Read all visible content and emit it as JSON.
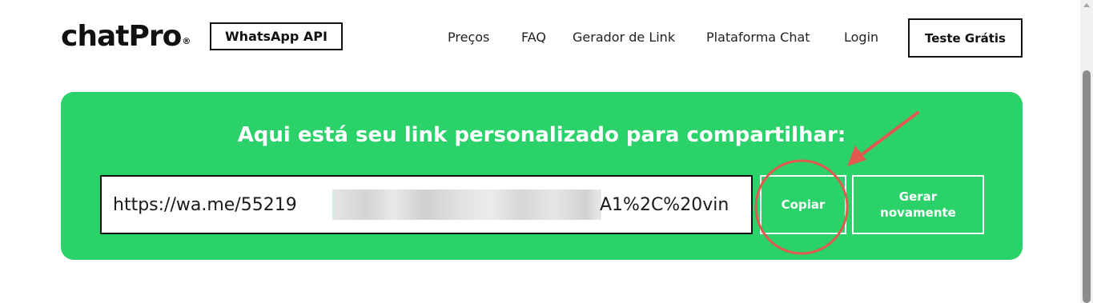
{
  "header": {
    "logo_text": "chatPro",
    "logo_mark": "®",
    "badge_label": "WhatsApp API",
    "nav": [
      {
        "label": "Preços"
      },
      {
        "label": "FAQ"
      },
      {
        "label": "Gerador de Link"
      },
      {
        "label": "Plataforma Chat"
      },
      {
        "label": "Login"
      }
    ],
    "cta_label": "Teste Grátis"
  },
  "panel": {
    "title": "Aqui está seu link personalizado para compartilhar:",
    "link_prefix": "https://wa.me/55219",
    "link_suffix": "A1%2C%20vin",
    "copy_label": "Copiar",
    "regenerate_label": "Gerar novamente"
  },
  "colors": {
    "panel_green": "#2bd26a",
    "annotation_red": "#e05a4f",
    "text_dark": "#111111"
  },
  "icons": {
    "annotation": [
      "red-circle-highlight",
      "red-arrow-pointer"
    ]
  }
}
